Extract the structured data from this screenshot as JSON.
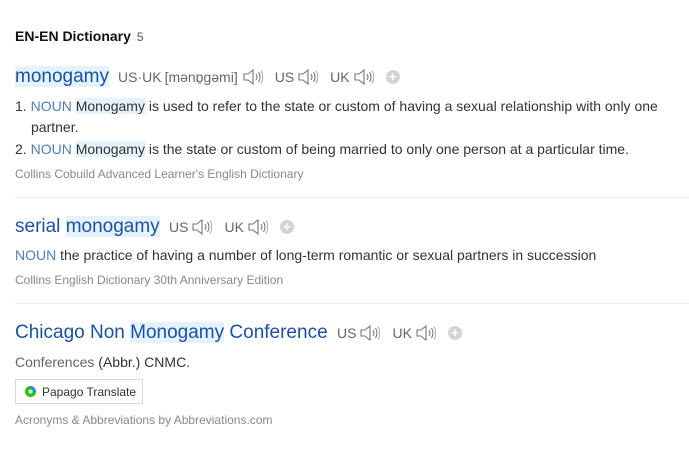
{
  "header": {
    "title": "EN-EN Dictionary",
    "count": "5"
  },
  "entries": [
    {
      "word": "monogamy",
      "pron_label": "US·UK",
      "ipa": "[mənɒ̱ɡəmi]",
      "us_label": "US",
      "uk_label": "UK",
      "defs": [
        {
          "num": "1.",
          "pos": "NOUN",
          "hl": "Monogamy",
          "text": " is used to refer to the state or custom of having a sexual relationship with only one",
          "text2": "partner."
        },
        {
          "num": "2.",
          "pos": "NOUN",
          "hl": "Monogamy",
          "text": " is the state or custom of being married to only one person at a particular time."
        }
      ],
      "source": "Collins Cobuild Advanced Learner's English Dictionary"
    },
    {
      "word_plain": "serial ",
      "word_hl": "monogamy",
      "us_label": "US",
      "uk_label": "UK",
      "pos": "NOUN",
      "def": "the practice of having a number of long-term romantic or sexual partners in succession",
      "source": "Collins English Dictionary 30th Anniversary Edition"
    },
    {
      "word_plain": "Chicago Non ",
      "word_hl": "Monogamy",
      "word_tail": " Conference",
      "us_label": "US",
      "uk_label": "UK",
      "category": "Conferences",
      "def": "(Abbr.) CNMC.",
      "source": "Acronyms & Abbreviations by Abbreviations.com"
    }
  ],
  "papago": {
    "label": "Papago Translate"
  },
  "icons": {
    "speaker": "speaker-icon",
    "add": "plus-icon",
    "papago": "papago-logo-icon"
  },
  "colors": {
    "link": "#1e50a2",
    "highlight": "#e4f2fb",
    "pos": "#4d7fb8",
    "muted": "#888888"
  }
}
